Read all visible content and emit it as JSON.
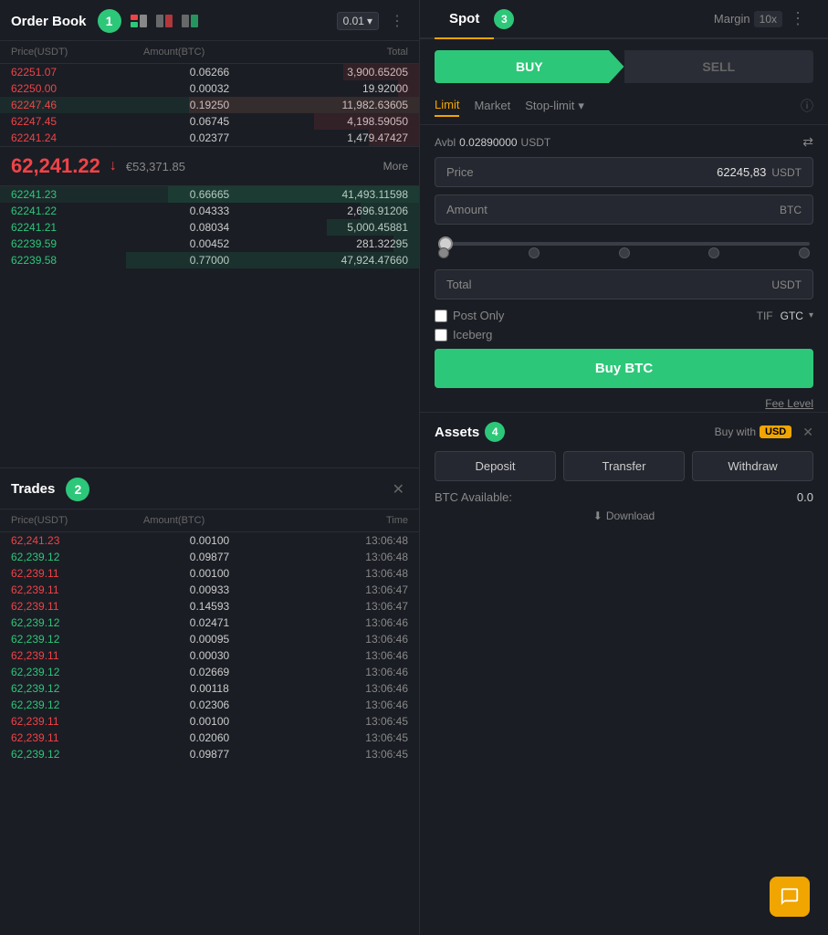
{
  "orderBook": {
    "title": "Order Book",
    "badge": "1",
    "decimal": "0.01",
    "colHeaders": [
      "Price(USDT)",
      "Amount(BTC)",
      "Total"
    ],
    "sellRows": [
      {
        "price": "62251.07",
        "amount": "0.06266",
        "total": "3,900.65205",
        "barWidth": "18"
      },
      {
        "price": "62250.00",
        "amount": "0.00032",
        "total": "19.92000",
        "barWidth": "5"
      },
      {
        "price": "62247.46",
        "amount": "0.19250",
        "total": "11,982.63605",
        "barWidth": "55",
        "highlighted": true
      },
      {
        "price": "62247.45",
        "amount": "0.06745",
        "total": "4,198.59050",
        "barWidth": "25"
      },
      {
        "price": "62241.24",
        "amount": "0.02377",
        "total": "1,479.47427",
        "barWidth": "12"
      }
    ],
    "currentPrice": "62,241.22",
    "priceArrow": "↓",
    "eurPrice": "€53,371.85",
    "moreLabel": "More",
    "buyRows": [
      {
        "price": "62241.23",
        "amount": "0.66665",
        "total": "41,493.11598",
        "barWidth": "60",
        "highlighted": true
      },
      {
        "price": "62241.22",
        "amount": "0.04333",
        "total": "2,696.91206",
        "barWidth": "14"
      },
      {
        "price": "62241.21",
        "amount": "0.08034",
        "total": "5,000.45881",
        "barWidth": "22"
      },
      {
        "price": "62239.59",
        "amount": "0.00452",
        "total": "281.32295",
        "barWidth": "6"
      },
      {
        "price": "62239.58",
        "amount": "0.77000",
        "total": "47,924.47660",
        "barWidth": "70"
      }
    ]
  },
  "trades": {
    "title": "Trades",
    "badge": "2",
    "colHeaders": [
      "Price(USDT)",
      "Amount(BTC)",
      "Time"
    ],
    "rows": [
      {
        "price": "62,241.23",
        "amount": "0.00100",
        "time": "13:06:48",
        "color": "red"
      },
      {
        "price": "62,239.12",
        "amount": "0.09877",
        "time": "13:06:48",
        "color": "green"
      },
      {
        "price": "62,239.11",
        "amount": "0.00100",
        "time": "13:06:48",
        "color": "red"
      },
      {
        "price": "62,239.11",
        "amount": "0.00933",
        "time": "13:06:47",
        "color": "red"
      },
      {
        "price": "62,239.11",
        "amount": "0.14593",
        "time": "13:06:47",
        "color": "red"
      },
      {
        "price": "62,239.12",
        "amount": "0.02471",
        "time": "13:06:46",
        "color": "green"
      },
      {
        "price": "62,239.12",
        "amount": "0.00095",
        "time": "13:06:46",
        "color": "green"
      },
      {
        "price": "62,239.11",
        "amount": "0.00030",
        "time": "13:06:46",
        "color": "red"
      },
      {
        "price": "62,239.12",
        "amount": "0.02669",
        "time": "13:06:46",
        "color": "green"
      },
      {
        "price": "62,239.12",
        "amount": "0.00118",
        "time": "13:06:46",
        "color": "green"
      },
      {
        "price": "62,239.12",
        "amount": "0.02306",
        "time": "13:06:46",
        "color": "green"
      },
      {
        "price": "62,239.11",
        "amount": "0.00100",
        "time": "13:06:45",
        "color": "red"
      },
      {
        "price": "62,239.11",
        "amount": "0.02060",
        "time": "13:06:45",
        "color": "red"
      },
      {
        "price": "62,239.12",
        "amount": "0.09877",
        "time": "13:06:45",
        "color": "green"
      }
    ]
  },
  "trading": {
    "tabs": [
      {
        "label": "Spot",
        "active": true
      },
      {
        "label": "Margin",
        "active": false
      },
      {
        "label": "10x",
        "badge": true
      }
    ],
    "badge": "3",
    "buyLabel": "BUY",
    "sellLabel": "SELL",
    "orderTypes": [
      {
        "label": "Limit",
        "active": true
      },
      {
        "label": "Market",
        "active": false
      },
      {
        "label": "Stop-limit",
        "active": false
      }
    ],
    "avbl": "0.02890000",
    "avblCurrency": "USDT",
    "priceLabel": "Price",
    "priceValue": "62245,83",
    "priceCurrency": "USDT",
    "amountLabel": "Amount",
    "amountCurrency": "BTC",
    "totalLabel": "Total",
    "totalCurrency": "USDT",
    "postOnly": "Post Only",
    "tif": "TIF",
    "gtc": "GTC",
    "iceberg": "Iceberg",
    "buyBtcLabel": "Buy BTC",
    "feeLevelLabel": "Fee Level"
  },
  "assets": {
    "title": "Assets",
    "badge": "4",
    "buyWith": "Buy with",
    "currency": "USD",
    "deposit": "Deposit",
    "transfer": "Transfer",
    "withdraw": "Withdraw",
    "btcAvailable": "BTC Available:",
    "btcValue": "0.0",
    "downloadLabel": "Download"
  }
}
